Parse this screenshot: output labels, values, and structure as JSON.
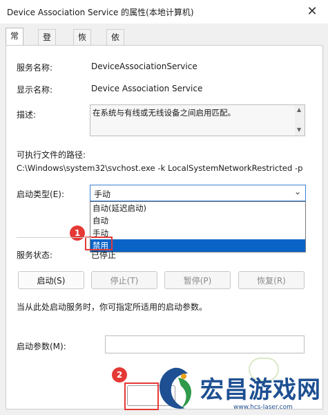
{
  "window": {
    "title": "Device Association Service 的属性(本地计算机)"
  },
  "tabs": [
    {
      "label": "常规",
      "active": true
    },
    {
      "label": "登录",
      "active": false
    },
    {
      "label": "恢复",
      "active": false
    },
    {
      "label": "依存关系",
      "active": false
    }
  ],
  "general": {
    "service_name_label": "服务名称:",
    "service_name_value": "DeviceAssociationService",
    "display_name_label": "显示名称:",
    "display_name_value": "Device Association Service",
    "description_label": "描述:",
    "description_value": "在系统与有线或无线设备之间启用匹配。",
    "exec_path_label": "可执行文件的路径:",
    "exec_path_value": "C:\\Windows\\system32\\svchost.exe -k LocalSystemNetworkRestricted -p",
    "startup_type_label": "启动类型(E):",
    "startup_type_value": "手动",
    "startup_options": [
      "自动(延迟启动)",
      "自动",
      "手动",
      "禁用"
    ],
    "highlighted_option": "禁用",
    "status_label": "服务状态:",
    "status_value": "已停止",
    "buttons": {
      "start": "启动(S)",
      "stop": "停止(T)",
      "pause": "暂停(P)",
      "resume": "恢复(R)"
    },
    "hint": "当从此处启动服务时，你可指定所适用的启动参数。",
    "param_label": "启动参数(M):",
    "param_value": ""
  },
  "annotations": {
    "marker1": "1",
    "marker2": "2",
    "accent_color": "#e53935"
  },
  "watermark": {
    "text": "宏昌游戏网",
    "url": "www.hcs-laser.com"
  }
}
